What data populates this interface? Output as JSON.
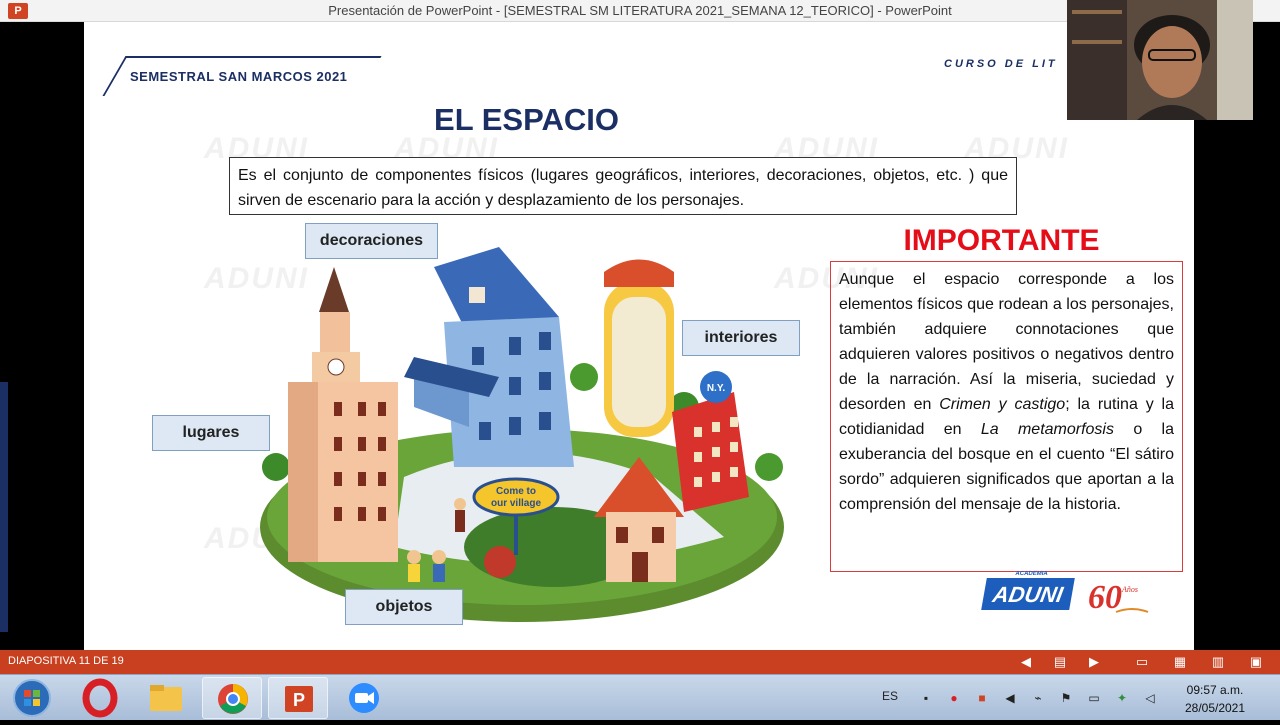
{
  "window": {
    "title": "Presentación de PowerPoint - [SEMESTRAL SM LITERATURA 2021_SEMANA 12_TEORICO] - PowerPoint",
    "app_badge": "P"
  },
  "slide": {
    "brand": "SEMESTRAL SAN MARCOS 2021",
    "course": "CURSO DE LIT",
    "title": "EL ESPACIO",
    "definition": "Es el conjunto de componentes físicos (lugares geográficos, interiores, decoraciones, objetos, etc. ) que sirven de escenario para la acción y desplazamiento de los personajes.",
    "labels": {
      "decoraciones": "decoraciones",
      "interiores": "interiores",
      "lugares": "lugares",
      "objetos": "objetos"
    },
    "illustration": {
      "sign_line1": "Come to",
      "sign_line2": "our village",
      "ny_badge": "N.Y."
    },
    "important": {
      "heading": "IMPORTANTE",
      "text_1": "Aunque el espacio corresponde a los elementos físicos que rodean a los personajes, también adquiere connotaciones que adquieren valores positivos o negativos dentro de la narración. Así la miseria, suciedad y desorden en ",
      "em_1": "Crimen y castigo",
      "text_2": "; la rutina y la cotidianidad en ",
      "em_2": "La metamorfosis",
      "text_3": " o la exuberancia del bosque en el cuento “El sátiro sordo” adquieren significados que aportan a la comprensión del mensaje de la historia."
    },
    "logos": {
      "aduni": "ADUNI",
      "aduni_small": "ACADEMIA",
      "sixty": "60",
      "sixty_small": "Años"
    },
    "watermark": "ADUNI"
  },
  "statusbar": {
    "slide_counter": "DIAPOSITIVA 11 DE 19"
  },
  "taskbar": {
    "language": "ES",
    "time": "09:57 a.m.",
    "date": "28/05/2021"
  },
  "colors": {
    "brand_navy": "#1b2f64",
    "important_red": "#e50e18",
    "statusbar": "#c8401f",
    "label_fill": "#dde8f4"
  }
}
